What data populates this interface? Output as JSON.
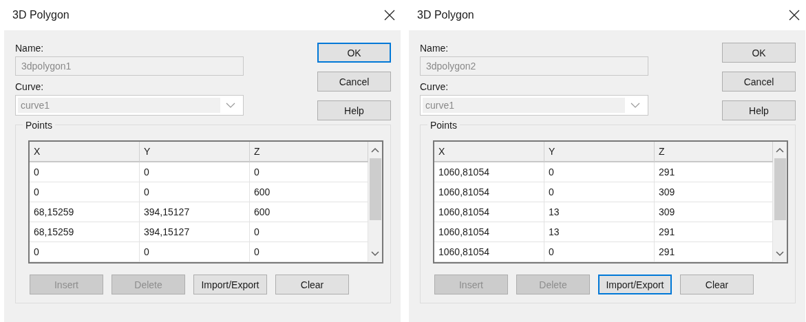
{
  "dialogs": [
    {
      "title": "3D Polygon",
      "name_label": "Name:",
      "name_value": "3dpolygon1",
      "name_disabled": true,
      "curve_label": "Curve:",
      "curve_value": "curve1",
      "curve_disabled": true,
      "side_buttons": [
        {
          "label": "OK",
          "focused": true,
          "disabled": false
        },
        {
          "label": "Cancel",
          "focused": false,
          "disabled": false
        },
        {
          "label": "Help",
          "focused": false,
          "disabled": false
        }
      ],
      "points": {
        "title": "Points",
        "columns": [
          "X",
          "Y",
          "Z"
        ],
        "rows": [
          [
            "0",
            "0",
            "0"
          ],
          [
            "0",
            "0",
            "600"
          ],
          [
            "68,15259",
            "394,15127",
            "600"
          ],
          [
            "68,15259",
            "394,15127",
            "0"
          ],
          [
            "0",
            "0",
            "0"
          ]
        ]
      },
      "bottom_buttons": [
        {
          "label": "Insert",
          "focused": false,
          "disabled": true
        },
        {
          "label": "Delete",
          "focused": false,
          "disabled": true
        },
        {
          "label": "Import/Export",
          "focused": false,
          "disabled": false
        },
        {
          "label": "Clear",
          "focused": false,
          "disabled": false
        }
      ]
    },
    {
      "title": "3D Polygon",
      "name_label": "Name:",
      "name_value": "3dpolygon2",
      "name_disabled": true,
      "curve_label": "Curve:",
      "curve_value": "curve1",
      "curve_disabled": true,
      "side_buttons": [
        {
          "label": "OK",
          "focused": false,
          "disabled": false
        },
        {
          "label": "Cancel",
          "focused": false,
          "disabled": false
        },
        {
          "label": "Help",
          "focused": false,
          "disabled": false
        }
      ],
      "points": {
        "title": "Points",
        "columns": [
          "X",
          "Y",
          "Z"
        ],
        "rows": [
          [
            "1060,81054",
            "0",
            "291"
          ],
          [
            "1060,81054",
            "0",
            "309"
          ],
          [
            "1060,81054",
            "13",
            "309"
          ],
          [
            "1060,81054",
            "13",
            "291"
          ],
          [
            "1060,81054",
            "0",
            "291"
          ]
        ]
      },
      "bottom_buttons": [
        {
          "label": "Insert",
          "focused": false,
          "disabled": true
        },
        {
          "label": "Delete",
          "focused": false,
          "disabled": true
        },
        {
          "label": "Import/Export",
          "focused": true,
          "disabled": false
        },
        {
          "label": "Clear",
          "focused": false,
          "disabled": false
        }
      ]
    }
  ]
}
